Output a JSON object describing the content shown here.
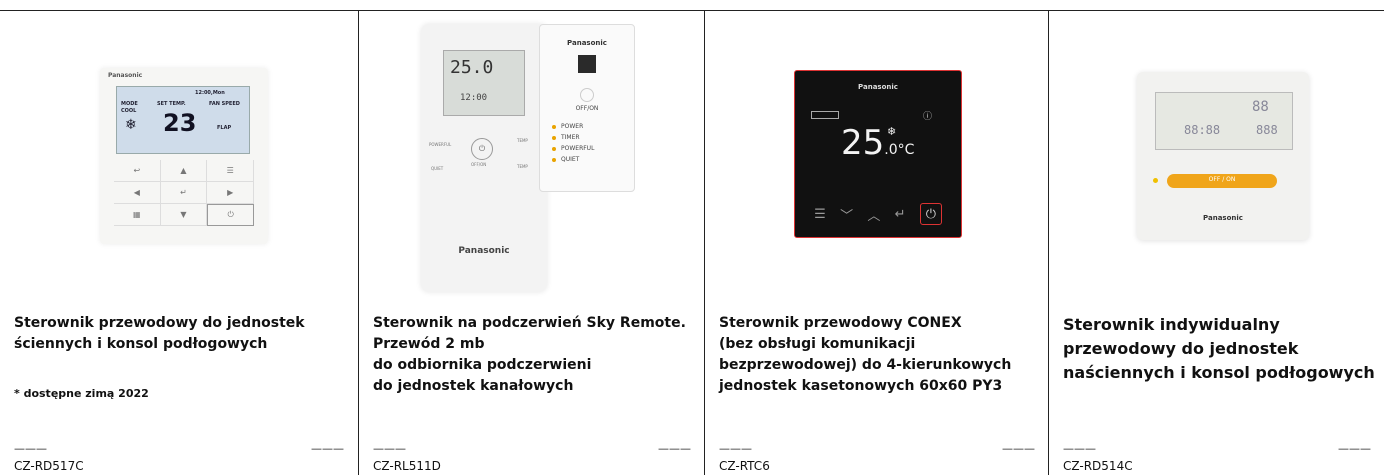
{
  "products": [
    {
      "title_lines": [
        "Sterownik przewodowy do jednostek",
        "ściennych i konsol podłogowych"
      ],
      "note": "* dostępne zimą 2022",
      "dash_left": "———",
      "dash_right": "———",
      "code": "CZ-RD517C",
      "device": {
        "brand": "Panasonic",
        "screen_time": "12:00,Mon",
        "screen_mode": "MODE",
        "screen_mode_value": "COOL",
        "screen_set_temp": "SET TEMP.",
        "screen_fan_speed": "FAN SPEED",
        "screen_flap": "FLAP",
        "screen_temp": "23"
      }
    },
    {
      "title_lines": [
        "Sterownik na podczerwień Sky Remote.",
        "Przewód 2 mb",
        "do odbiornika podczerwieni",
        "do jednostek kanałowych"
      ],
      "dash_left": "———",
      "dash_right": "———",
      "code": "CZ-RL511D",
      "device": {
        "remote_display_temp": "25.0",
        "remote_display_time": "12:00",
        "remote_brand": "Panasonic",
        "remote_off_on": "OFF/ON",
        "remote_powerful": "POWERFUL",
        "remote_quiet": "QUIET",
        "remote_temp": "TEMP",
        "receiver_brand": "Panasonic",
        "receiver_off_on": "OFF/ON",
        "receiver_list": [
          "POWER",
          "TIMER",
          "POWERFUL",
          "QUIET"
        ]
      }
    },
    {
      "title_lines": [
        "Sterownik przewodowy CONEX",
        "(bez obsługi komunikacji",
        "bezprzewodowej) do 4-kierunkowych",
        "jednostek kasetonowych 60x60 PY3"
      ],
      "dash_left": "———",
      "dash_right": "———",
      "code": "CZ-RTC6",
      "device": {
        "brand": "Panasonic",
        "temp": "25",
        "temp_decimal": ".0",
        "unit": "°C"
      }
    },
    {
      "title_lines": [
        "Sterownik indywidualny",
        "przewodowy do jednostek",
        "naściennych i konsol podłogowych"
      ],
      "dash_left": "———",
      "dash_right": "———",
      "code": "CZ-RD514C",
      "device": {
        "brand": "Panasonic",
        "off_on": "OFF / ON",
        "lcd_value_1": "88",
        "lcd_value_2": "88:88",
        "lcd_value_3": "888"
      }
    }
  ],
  "colors": {
    "divider": "#222222",
    "accent_orange": "#f0a51a",
    "conex_border": "#dd3333"
  }
}
